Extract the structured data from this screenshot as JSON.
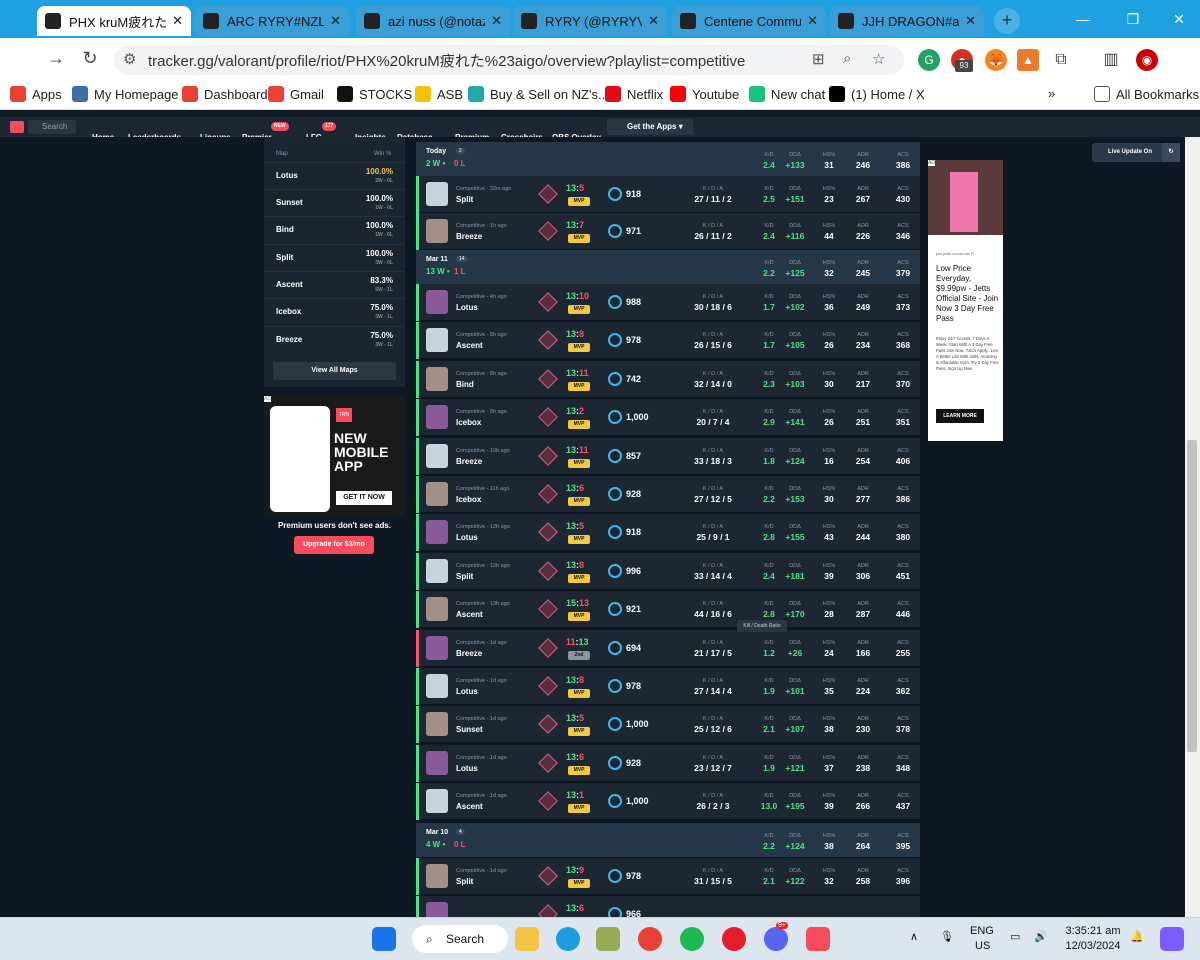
{
  "browser": {
    "tabs": [
      {
        "label": "PHX kruM疲れた#a",
        "icon": "trn-icon",
        "active": true
      },
      {
        "label": "ARC RYRY#NZL's C",
        "icon": "trn-icon"
      },
      {
        "label": "azi nuss (@notaziu",
        "icon": "x-icon"
      },
      {
        "label": "RYRY (@RYRYValo",
        "icon": "x-icon"
      },
      {
        "label": "Centene Commun",
        "icon": "centene-icon"
      },
      {
        "label": "JJH DRAGON#aaa",
        "icon": "trn-icon"
      }
    ],
    "url": "tracker.gg/valorant/profile/riot/PHX%20kruM疲れた%23aigo/overview?playlist=competitive",
    "ext_badge": "93",
    "bookmarks": [
      "Apps",
      "My Homepage",
      "Dashboard",
      "Gmail",
      "STOCKS",
      "ASB",
      "Buy & Sell on NZ's...",
      "Netflix",
      "Youtube",
      "New chat",
      "(1) Home / X"
    ],
    "all_bookmarks": "All Bookmarks",
    "more": "»"
  },
  "site_nav": {
    "search": "Search",
    "items": [
      "Home",
      "Leaderboards",
      "Lineups",
      "Premier",
      "LFG",
      "Insights",
      "Database",
      "Premium",
      "Crosshairs",
      "OBS Overlay"
    ],
    "premier_badge": "NEW",
    "lfg_badge": "177",
    "get_apps": "Get the Apps"
  },
  "live_update": "Live Update On",
  "maps": {
    "col_map": "Map",
    "col_win": "Win %",
    "rows": [
      {
        "name": "Lotus",
        "pct": "100.0%",
        "wl": "2W - 0L"
      },
      {
        "name": "Sunset",
        "pct": "100.0%",
        "wl": "1W - 0L"
      },
      {
        "name": "Bind",
        "pct": "100.0%",
        "wl": "1W - 0L"
      },
      {
        "name": "Split",
        "pct": "100.0%",
        "wl": "3W - 0L"
      },
      {
        "name": "Ascent",
        "pct": "83.3%",
        "wl": "5W - 1L"
      },
      {
        "name": "Icebox",
        "pct": "75.0%",
        "wl": "3W - 1L"
      },
      {
        "name": "Breeze",
        "pct": "75.0%",
        "wl": "3W - 1L"
      }
    ],
    "view_all": "View All Maps"
  },
  "left_ad": {
    "brand": "TRN",
    "headline": "NEW MOBILE APP",
    "cta": "GET IT NOW",
    "ad_label": "AD"
  },
  "premium_note": "Premium users don't see ads.",
  "upgrade": "Upgrade for $3/mo",
  "right_ad": {
    "ad_label": "AD",
    "url": "join.jetts.co.nz/Low P...",
    "headline": "Low Price Everyday, $9.99pw - Jetts Official Site - Join Now 3 Day Free Pass",
    "body": "Enjoy 24/7 Access, 7 Days A Week. Start With A 3 Day Free Pass Join Now. T&Cs Apply.. Live A Better Life With Jetts. Amazing & Affordable Gym. Try 3 Day Free Pass. Sign Up Now.",
    "cta": "LEARN MORE"
  },
  "tooltip": "Kill / Death Ratio",
  "labels": {
    "kda": "K / D / A",
    "kd": "K/D",
    "ddd": "DDΔ",
    "hs": "HS%",
    "adr": "ADR",
    "acs": "ACS"
  },
  "days": [
    {
      "date": "Today",
      "count": "2",
      "w": "2",
      "l": "0",
      "kd": "2.4",
      "dd": "+133",
      "hs": "31",
      "adr": "246",
      "acs": "386"
    },
    {
      "date": "Mar 11",
      "count": "14",
      "w": "13",
      "l": "1",
      "kd": "2.2",
      "dd": "+125",
      "hs": "32",
      "adr": "245",
      "acs": "379"
    },
    {
      "date": "Mar 10",
      "count": "4",
      "w": "4",
      "l": "0",
      "kd": "2.2",
      "dd": "+124",
      "hs": "38",
      "adr": "264",
      "acs": "395"
    }
  ],
  "matches": [
    {
      "time": "Competitive - 32m ago",
      "map": "Split",
      "a": "13",
      "b": "5",
      "badge": "MVP",
      "rr": "918",
      "kda": "27 / 11 / 2",
      "kd": "2.5",
      "dd": "+151",
      "hs": "23",
      "adr": "267",
      "acs": "430",
      "win": true
    },
    {
      "time": "Competitive - 1h ago",
      "map": "Breeze",
      "a": "13",
      "b": "7",
      "badge": "MVP",
      "rr": "971",
      "kda": "26 / 11 / 2",
      "kd": "2.4",
      "dd": "+116",
      "hs": "44",
      "adr": "226",
      "acs": "346",
      "win": true
    },
    {
      "time": "Competitive - 4h ago",
      "map": "Lotus",
      "a": "13",
      "b": "10",
      "badge": "MVP",
      "rr": "988",
      "kda": "30 / 18 / 6",
      "kd": "1.7",
      "dd": "+102",
      "hs": "36",
      "adr": "249",
      "acs": "373",
      "win": true
    },
    {
      "time": "Competitive - 5h ago",
      "map": "Ascent",
      "a": "13",
      "b": "8",
      "badge": "MVP",
      "rr": "978",
      "kda": "26 / 15 / 6",
      "kd": "1.7",
      "dd": "+105",
      "hs": "26",
      "adr": "234",
      "acs": "368",
      "win": true
    },
    {
      "time": "Competitive - 8h ago",
      "map": "Bind",
      "a": "13",
      "b": "11",
      "badge": "MVP",
      "rr": "742",
      "kda": "32 / 14 / 0",
      "kd": "2.3",
      "dd": "+103",
      "hs": "30",
      "adr": "217",
      "acs": "370",
      "win": true
    },
    {
      "time": "Competitive - 9h ago",
      "map": "Icebox",
      "a": "13",
      "b": "2",
      "badge": "MVP",
      "rr": "1,000",
      "kda": "20 / 7 / 4",
      "kd": "2.9",
      "dd": "+141",
      "hs": "26",
      "adr": "251",
      "acs": "351",
      "win": true
    },
    {
      "time": "Competitive - 10h ago",
      "map": "Breeze",
      "a": "13",
      "b": "11",
      "badge": "MVP",
      "rr": "857",
      "kda": "33 / 18 / 3",
      "kd": "1.8",
      "dd": "+124",
      "hs": "16",
      "adr": "254",
      "acs": "406",
      "win": true
    },
    {
      "time": "Competitive - 11h ago",
      "map": "Icebox",
      "a": "13",
      "b": "6",
      "badge": "MVP",
      "rr": "928",
      "kda": "27 / 12 / 5",
      "kd": "2.2",
      "dd": "+153",
      "hs": "30",
      "adr": "277",
      "acs": "386",
      "win": true
    },
    {
      "time": "Competitive - 12h ago",
      "map": "Lotus",
      "a": "13",
      "b": "5",
      "badge": "MVP",
      "rr": "918",
      "kda": "25 / 9 / 1",
      "kd": "2.8",
      "dd": "+155",
      "hs": "43",
      "adr": "244",
      "acs": "380",
      "win": true
    },
    {
      "time": "Competitive - 12h ago",
      "map": "Split",
      "a": "13",
      "b": "8",
      "badge": "MVP",
      "rr": "996",
      "kda": "33 / 14 / 4",
      "kd": "2.4",
      "dd": "+181",
      "hs": "39",
      "adr": "306",
      "acs": "451",
      "win": true
    },
    {
      "time": "Competitive - 13h ago",
      "map": "Ascent",
      "a": "15",
      "b": "13",
      "badge": "MVP",
      "rr": "921",
      "kda": "44 / 16 / 6",
      "kd": "2.8",
      "dd": "+170",
      "hs": "28",
      "adr": "287",
      "acs": "446",
      "win": true
    },
    {
      "time": "Competitive - 1d ago",
      "map": "Breeze",
      "a": "11",
      "b": "13",
      "badge": "2nd",
      "rr": "694",
      "kda": "21 / 17 / 5",
      "kd": "1.2",
      "dd": "+26",
      "hs": "24",
      "adr": "166",
      "acs": "255",
      "win": false
    },
    {
      "time": "Competitive - 1d ago",
      "map": "Lotus",
      "a": "13",
      "b": "8",
      "badge": "MVP",
      "rr": "978",
      "kda": "27 / 14 / 4",
      "kd": "1.9",
      "dd": "+101",
      "hs": "35",
      "adr": "224",
      "acs": "362",
      "win": true
    },
    {
      "time": "Competitive - 1d ago",
      "map": "Sunset",
      "a": "13",
      "b": "5",
      "badge": "MVP",
      "rr": "1,000",
      "kda": "25 / 12 / 6",
      "kd": "2.1",
      "dd": "+107",
      "hs": "38",
      "adr": "230",
      "acs": "378",
      "win": true
    },
    {
      "time": "Competitive - 1d ago",
      "map": "Lotus",
      "a": "13",
      "b": "6",
      "badge": "MVP",
      "rr": "928",
      "kda": "23 / 12 / 7",
      "kd": "1.9",
      "dd": "+121",
      "hs": "37",
      "adr": "238",
      "acs": "348",
      "win": true
    },
    {
      "time": "Competitive - 1d ago",
      "map": "Ascent",
      "a": "13",
      "b": "1",
      "badge": "MVP",
      "rr": "1,000",
      "kda": "26 / 2 / 3",
      "kd": "13.0",
      "dd": "+195",
      "hs": "39",
      "adr": "266",
      "acs": "437",
      "win": true
    },
    {
      "time": "Competitive - 1d ago",
      "map": "Split",
      "a": "13",
      "b": "9",
      "badge": "MVP",
      "rr": "978",
      "kda": "31 / 15 / 5",
      "kd": "2.1",
      "dd": "+122",
      "hs": "32",
      "adr": "258",
      "acs": "396",
      "win": true
    },
    {
      "time": "",
      "map": "",
      "a": "13",
      "b": "6",
      "badge": "",
      "rr": "966",
      "kda": "",
      "kd": "",
      "dd": "",
      "hs": "",
      "adr": "",
      "acs": "",
      "win": true
    }
  ],
  "taskbar": {
    "search": "Search",
    "lang1": "ENG",
    "lang2": "US",
    "time": "3:35:21 am",
    "date": "12/03/2024",
    "discord_badge": "9+"
  },
  "colors": {
    "win": "#4ee28b",
    "loss": "#f4546a",
    "mvp": "#f5c842",
    "accent": "#f84b5b"
  }
}
